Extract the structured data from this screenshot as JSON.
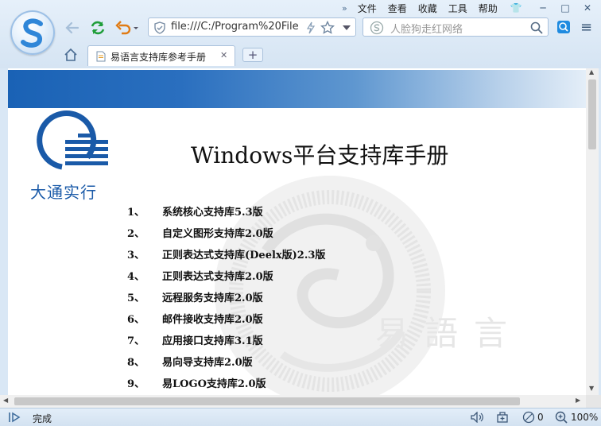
{
  "menu": {
    "items": [
      "文件",
      "查看",
      "收藏",
      "工具",
      "帮助"
    ],
    "more": "»"
  },
  "window": {
    "skin": "👕",
    "minimize": "─",
    "maximize": "□",
    "close": "✕"
  },
  "address_bar": {
    "url": "file:///C:/Program%20File"
  },
  "search_bar": {
    "placeholder": "人脸狗走红网络"
  },
  "tab": {
    "title": "易语言支持库参考手册",
    "close": "✕",
    "new_tab": "+"
  },
  "page": {
    "logo_text": "大通实行",
    "title": "Windows平台支持库手册",
    "watermark_text": "易語言",
    "toc": [
      {
        "num": "1、",
        "name": "系统核心支持库5.3版"
      },
      {
        "num": "2、",
        "name": "自定义图形支持库2.0版"
      },
      {
        "num": "3、",
        "name": "正则表达式支持库(Deelx版)2.3版"
      },
      {
        "num": "4、",
        "name": "正则表达式支持库2.0版"
      },
      {
        "num": "5、",
        "name": "远程服务支持库2.0版"
      },
      {
        "num": "6、",
        "name": "邮件接收支持库2.0版"
      },
      {
        "num": "7、",
        "name": "应用接口支持库3.1版"
      },
      {
        "num": "8、",
        "name": "易向导支持库2.0版"
      },
      {
        "num": "9、",
        "name": "易LOGO支持库2.0版"
      }
    ]
  },
  "status_bar": {
    "status": "完成",
    "count": "0",
    "zoom": "100%"
  },
  "colors": {
    "accent": "#1a62b5",
    "banner_end": "#e4eef8",
    "chrome": "#d9e7f5"
  }
}
